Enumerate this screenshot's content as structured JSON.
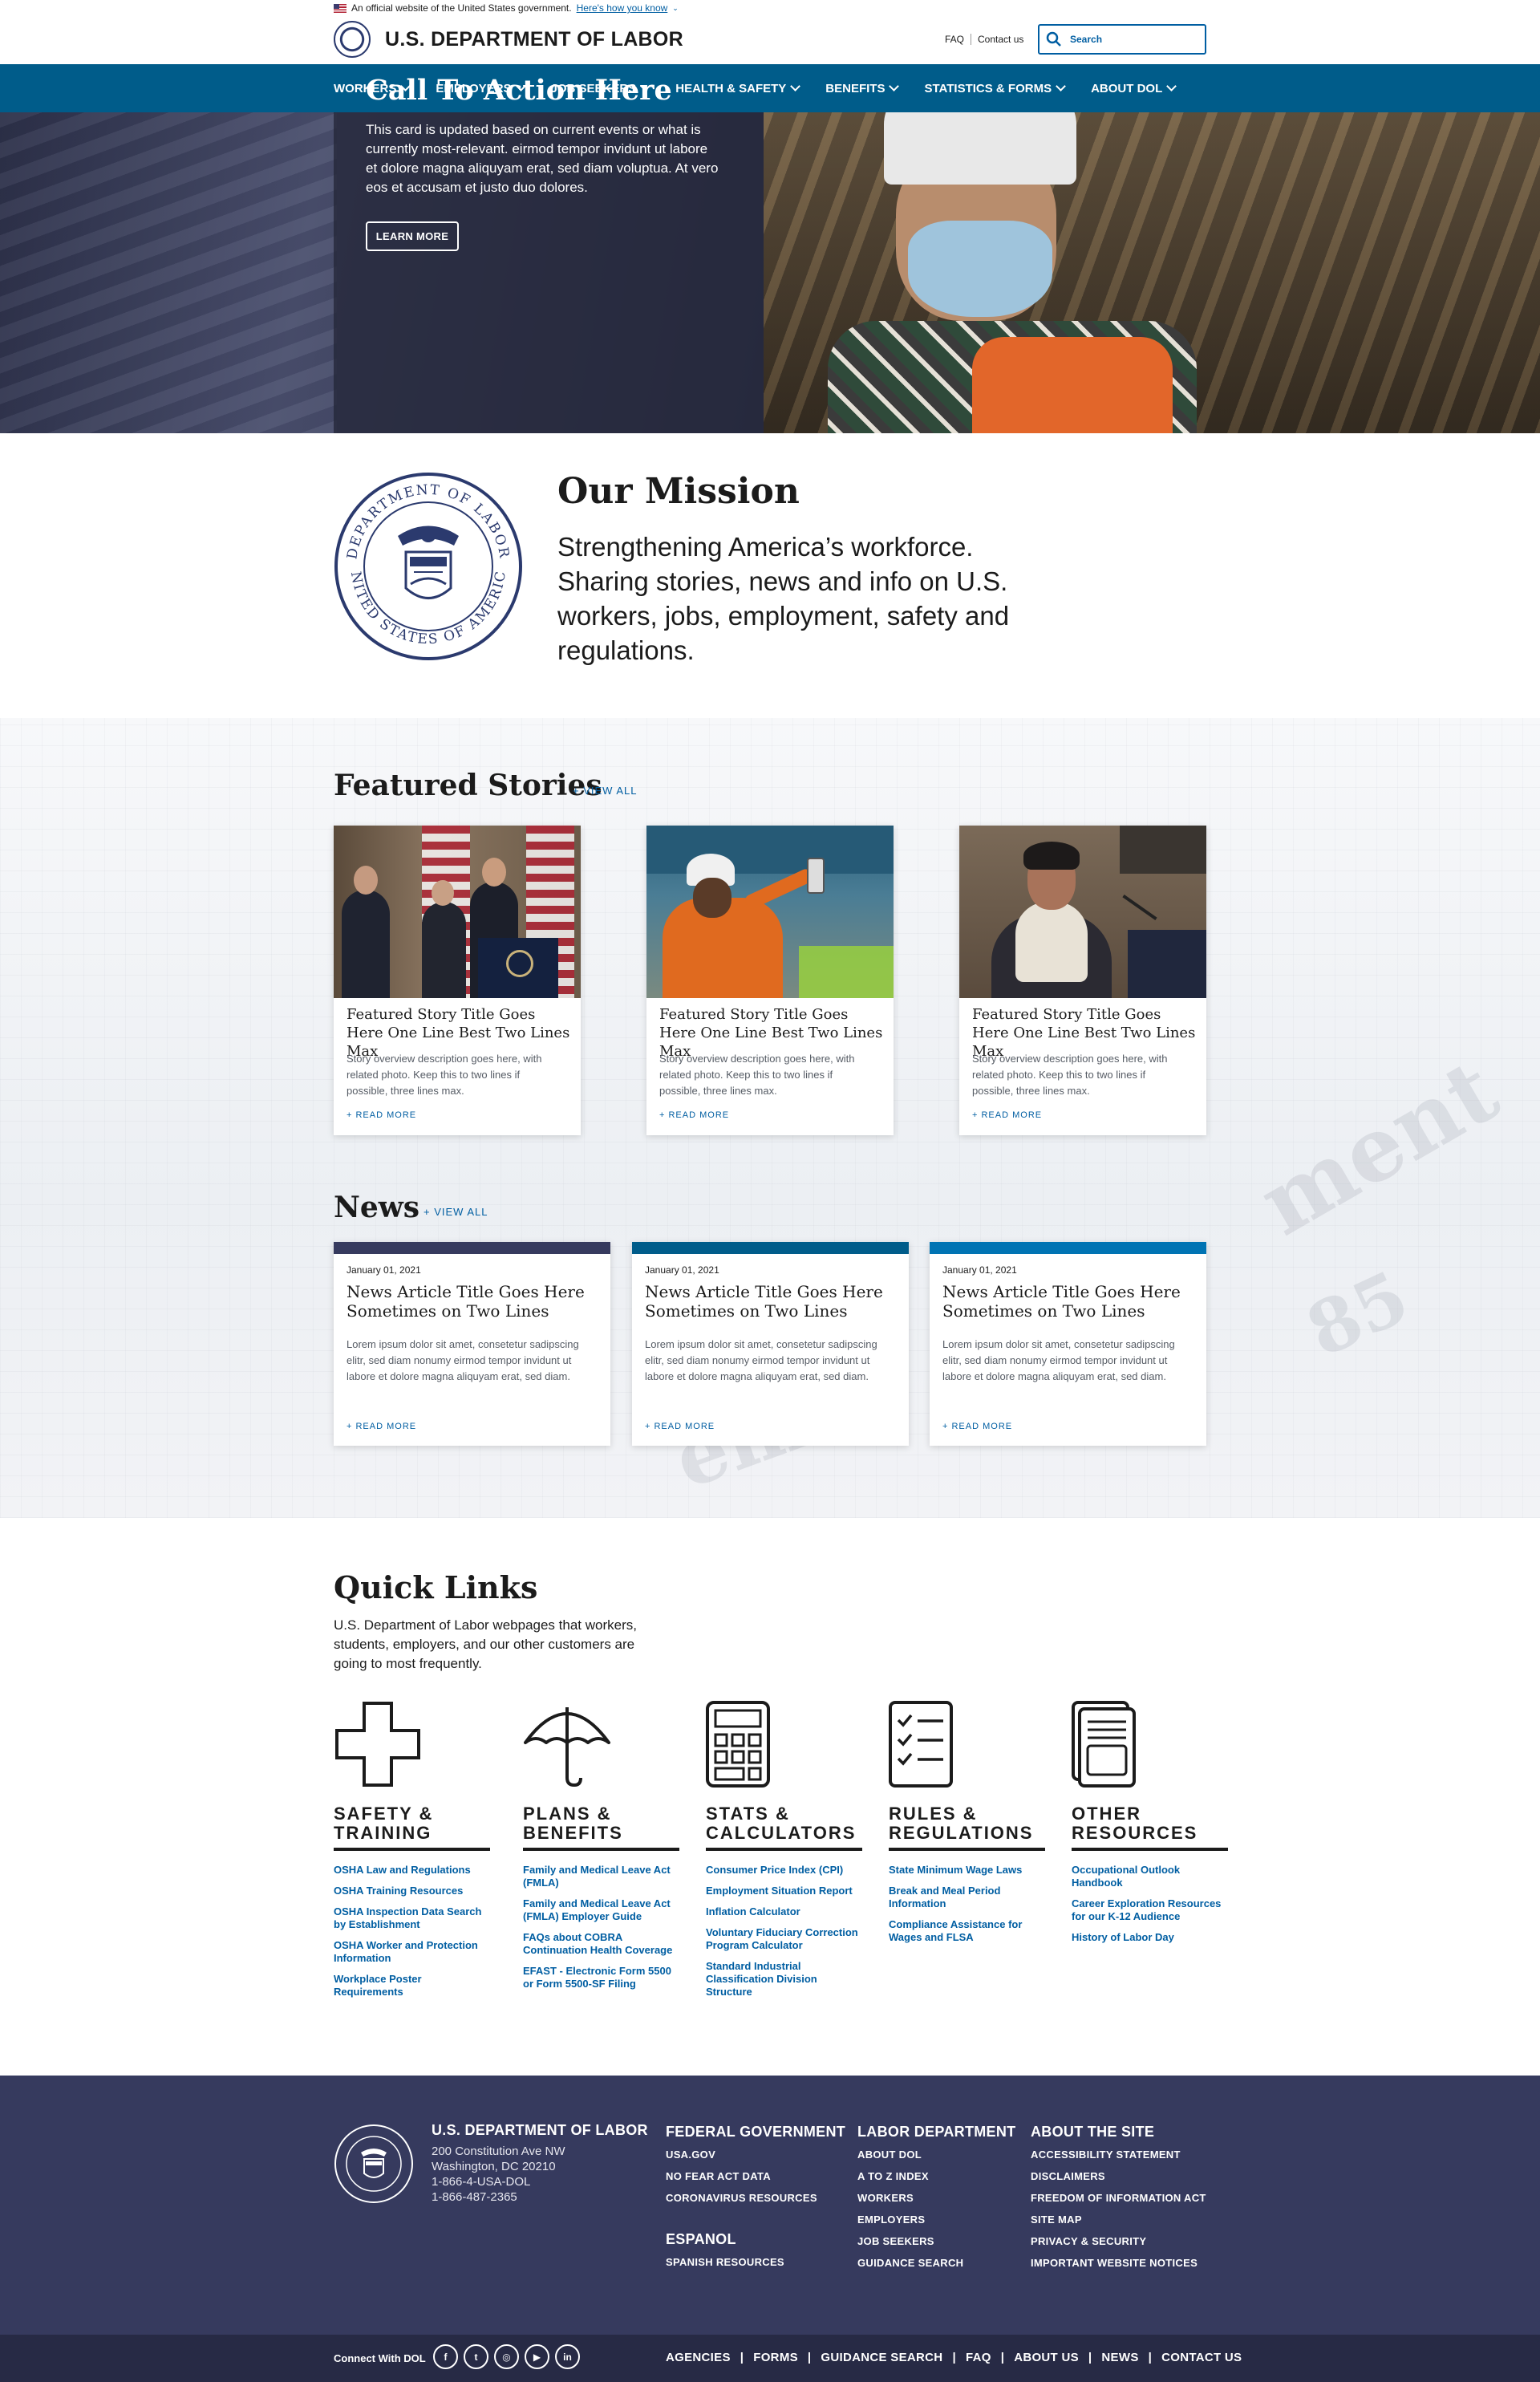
{
  "gov_banner": {
    "text": "An official website of the United States government.",
    "link": "Here's how you know"
  },
  "header": {
    "title": "U.S. DEPARTMENT OF LABOR",
    "faq": "FAQ",
    "contact": "Contact us",
    "search_placeholder": "Search"
  },
  "nav": {
    "items": [
      {
        "label": "WORKERS"
      },
      {
        "label": "EMPLOYERS"
      },
      {
        "label": "JOB SEEKERS"
      },
      {
        "label": "HEALTH & SAFETY"
      },
      {
        "label": "BENEFITS"
      },
      {
        "label": "STATISTICS & FORMS"
      },
      {
        "label": "ABOUT DOL"
      }
    ]
  },
  "hero": {
    "title": "Call To Action Here",
    "text": "This card is updated based on current events or what is currently most-relevant. eirmod tempor invidunt ut labore et dolore magna aliquyam erat, sed diam voluptua. At vero eos et accusam et justo duo dolores.",
    "button": "LEARN MORE"
  },
  "mission": {
    "title": "Our Mission",
    "text": "Strengthening America’s workforce. Sharing stories, news and info on U.S. workers, jobs, employment, safety and regulations."
  },
  "featured": {
    "title": "Featured Stories",
    "view_all": "+ VIEW ALL",
    "stories": [
      {
        "title": "Featured Story Title Goes Here One Line Best Two Lines Max",
        "desc": "Story overview description goes here, with related photo. Keep this to two lines if possible, three lines max.",
        "more": "+ READ MORE"
      },
      {
        "title": "Featured Story Title Goes Here One Line Best Two Lines Max",
        "desc": "Story overview description goes here, with related photo. Keep this to two lines if possible, three lines max.",
        "more": "+ READ MORE"
      },
      {
        "title": "Featured Story Title Goes Here One Line Best Two Lines Max",
        "desc": "Story overview description goes here, with related photo. Keep this to two lines if possible, three lines max.",
        "more": "+ READ MORE"
      }
    ]
  },
  "news": {
    "title": "News",
    "view_all": "+ VIEW ALL",
    "articles": [
      {
        "date": "January 01, 2021",
        "title": "News Article Title Goes Here Sometimes on Two Lines",
        "text": "Lorem ipsum dolor sit amet, consetetur sadipscing elitr, sed diam nonumy eirmod tempor invidunt ut labore et dolore magna aliquyam erat, sed diam.",
        "more": "+ READ MORE",
        "bar_color": "#363a5e"
      },
      {
        "date": "January 01, 2021",
        "title": "News Article Title Goes Here Sometimes on Two Lines",
        "text": "Lorem ipsum dolor sit amet, consetetur sadipscing elitr, sed diam nonumy eirmod tempor invidunt ut labore et dolore magna aliquyam erat, sed diam.",
        "more": "+ READ MORE",
        "bar_color": "#005c8a"
      },
      {
        "date": "January 01, 2021",
        "title": "News Article Title Goes Here Sometimes on Two Lines",
        "text": "Lorem ipsum dolor sit amet, consetetur sadipscing elitr, sed diam nonumy eirmod tempor invidunt ut labore et dolore magna aliquyam erat, sed diam.",
        "more": "+ READ MORE",
        "bar_color": "#0073b3"
      }
    ]
  },
  "quick_links": {
    "title": "Quick Links",
    "intro": "U.S. Department of Labor webpages that workers, students, employers, and our other customers are going to most frequently.",
    "columns": [
      {
        "icon": "cross-icon",
        "line1": "SAFETY &",
        "line2": "TRAINING",
        "links": [
          "OSHA Law and Regulations",
          "OSHA Training Resources",
          "OSHA Inspection Data Search by Establishment",
          "OSHA Worker and Protection Information",
          "Workplace Poster Requirements"
        ]
      },
      {
        "icon": "umbrella-icon",
        "line1": "PLANS &",
        "line2": "BENEFITS",
        "links": [
          "Family and Medical Leave Act (FMLA)",
          "Family and Medical Leave Act (FMLA) Employer Guide",
          "FAQs about COBRA Continuation Health Coverage",
          "EFAST - Electronic Form 5500 or Form 5500-SF Filing"
        ]
      },
      {
        "icon": "calculator-icon",
        "line1": "STATS &",
        "line2": "CALCULATORS",
        "links": [
          "Consumer Price Index (CPI)",
          "Employment Situation Report",
          "Inflation Calculator",
          "Voluntary Fiduciary Correction Program Calculator",
          "Standard Industrial Classification Division Structure"
        ]
      },
      {
        "icon": "checklist-icon",
        "line1": "RULES &",
        "line2": "REGULATIONS",
        "links": [
          "State Minimum Wage Laws",
          "Break and Meal Period Information",
          "Compliance Assistance for Wages and FLSA"
        ]
      },
      {
        "icon": "documents-icon",
        "line1": "OTHER",
        "line2": "RESOURCES",
        "links": [
          "Occupational Outlook Handbook",
          "Career Exploration Resources for our K-12 Audience",
          "History of Labor Day"
        ]
      }
    ]
  },
  "footer": {
    "org_name": "U.S. DEPARTMENT OF LABOR",
    "address1": "200 Constitution Ave NW",
    "address2": "Washington, DC 20210",
    "phone1": "1-866-4-USA-DOL",
    "phone2": "1-866-487-2365",
    "federal": {
      "title": "FEDERAL GOVERNMENT",
      "links": [
        "USA.GOV",
        "NO FEAR ACT DATA",
        "CORONAVIRUS RESOURCES"
      ]
    },
    "espanol": {
      "title": "ESPANOL",
      "links": [
        "SPANISH RESOURCES"
      ]
    },
    "labor": {
      "title": "LABOR DEPARTMENT",
      "links": [
        "ABOUT DOL",
        "A TO Z INDEX",
        "WORKERS",
        "EMPLOYERS",
        "JOB SEEKERS",
        "GUIDANCE SEARCH"
      ]
    },
    "about": {
      "title": "ABOUT THE SITE",
      "links": [
        "ACCESSIBILITY STATEMENT",
        "DISCLAIMERS",
        "FREEDOM OF INFORMATION ACT",
        "SITE MAP",
        "PRIVACY & SECURITY",
        "IMPORTANT WEBSITE NOTICES"
      ]
    },
    "connect": "Connect With DOL",
    "socials": [
      "facebook-icon",
      "twitter-icon",
      "instagram-icon",
      "youtube-icon",
      "linkedin-icon"
    ],
    "bottom_links": [
      "AGENCIES",
      "FORMS",
      "GUIDANCE SEARCH",
      "FAQ",
      "ABOUT US",
      "NEWS",
      "CONTACT US"
    ]
  }
}
